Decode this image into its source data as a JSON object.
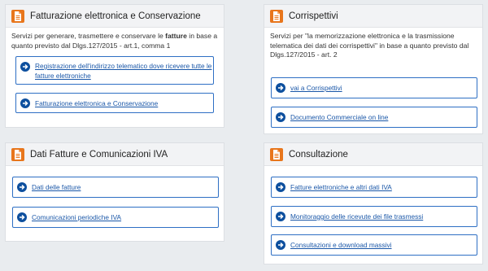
{
  "cards": {
    "fatturazione": {
      "title": "Fatturazione elettronica e Conservazione",
      "desc_pre": "Servizi per generare, trasmettere e conservare le ",
      "desc_bold": "fatture",
      "desc_post": " in base a quanto previsto dal Dlgs.127/2015 - art.1, comma 1",
      "links": [
        "Registrazione dell'indirizzo telematico dove ricevere tutte le fatture elettroniche",
        "Fatturazione elettronica e Conservazione"
      ]
    },
    "corrispettivi": {
      "title": "Corrispettivi",
      "desc": "Servizi per \"la memorizzazione elettronica e la trasmissione telematica dei dati dei corrispettivi\" in base a quanto previsto dal Dlgs.127/2015 - art. 2",
      "links": [
        "vai a Corrispettivi",
        "Documento Commerciale on line"
      ]
    },
    "dati_fatture": {
      "title": "Dati Fatture e Comunicazioni IVA",
      "links": [
        "Dati delle fatture",
        "Comunicazioni periodiche IVA"
      ]
    },
    "consultazione": {
      "title": "Consultazione",
      "links": [
        "Fatture elettroniche e altri dati IVA",
        "Monitoraggio delle ricevute dei file trasmessi",
        "Consultazioni e download massivi"
      ]
    }
  },
  "colors": {
    "icon_orange": "#e8761c",
    "link_blue": "#1a57a8",
    "button_border": "#2e6fc4",
    "arrow_circle": "#0d4f9e"
  },
  "icons": {
    "card_icon": "document-icon",
    "link_icon": "arrow-right-circle-icon"
  }
}
